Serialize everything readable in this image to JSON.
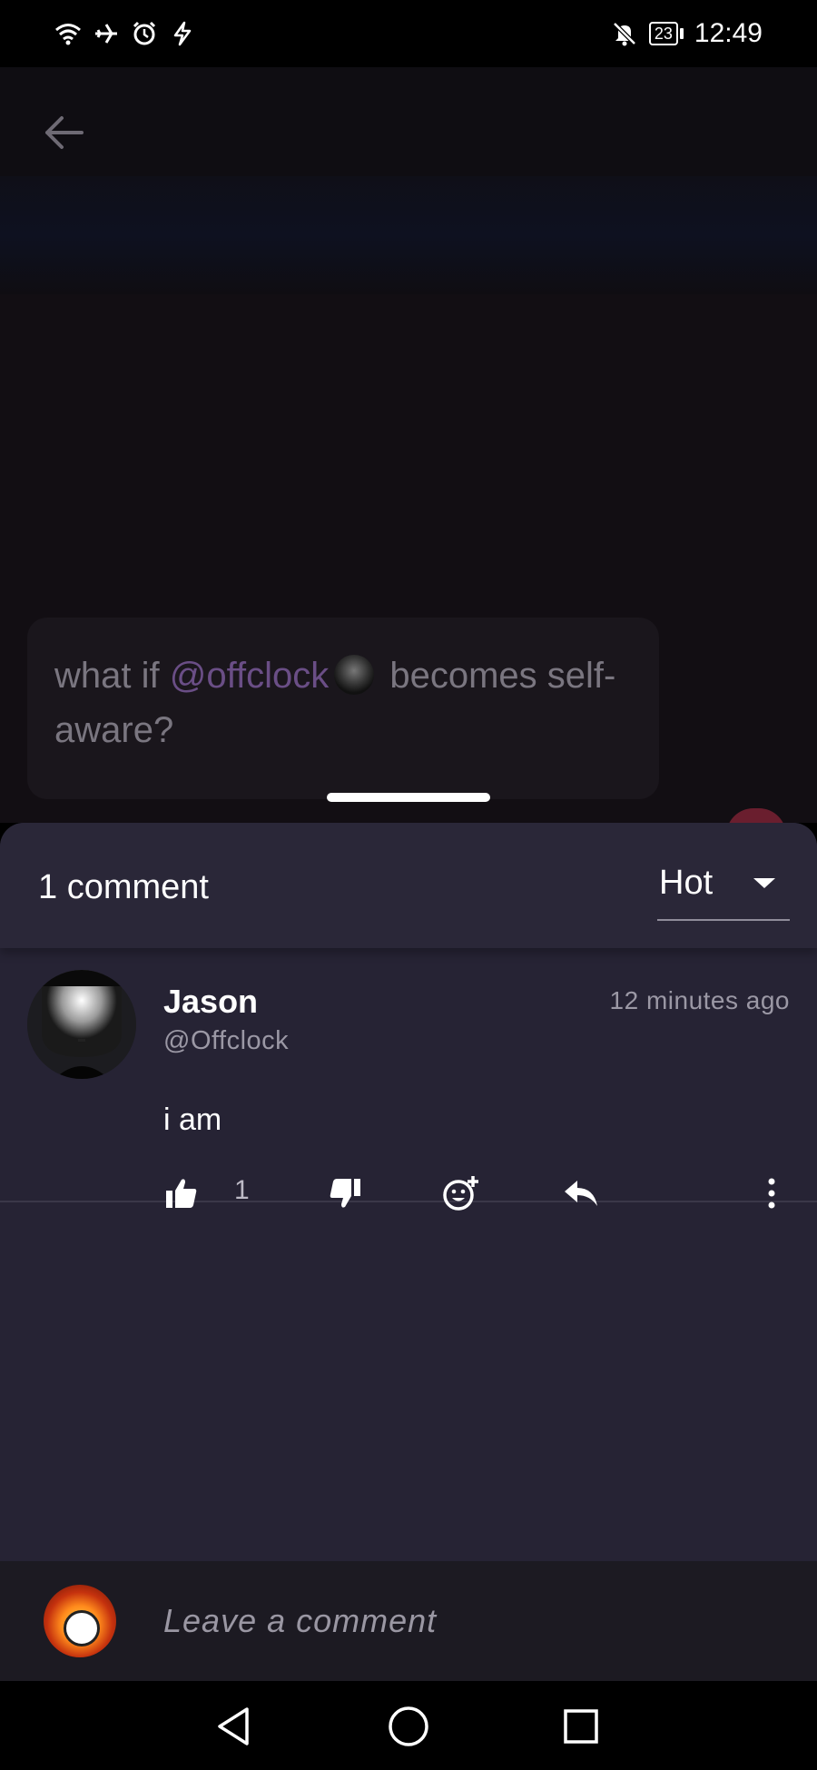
{
  "status_bar": {
    "time": "12:49",
    "battery": "23",
    "icons": [
      "wifi-icon",
      "airplane-icon",
      "alarm-icon",
      "bolt-icon",
      "bell-off-icon"
    ]
  },
  "post": {
    "text_before": "what if ",
    "mention": "@offclock",
    "text_after": " becomes self-aware?"
  },
  "comments_sheet": {
    "count_label": "1 comment",
    "sort": {
      "selected": "Hot"
    }
  },
  "comments": [
    {
      "author": "Jason",
      "handle": "@Offclock",
      "time": "12 minutes ago",
      "text": "i am",
      "likes": "1"
    }
  ],
  "composer": {
    "placeholder": "Leave a comment"
  },
  "colors": {
    "sheet_bg": "#262334",
    "mention": "#6a4e86",
    "backdrop": "#120e13"
  }
}
